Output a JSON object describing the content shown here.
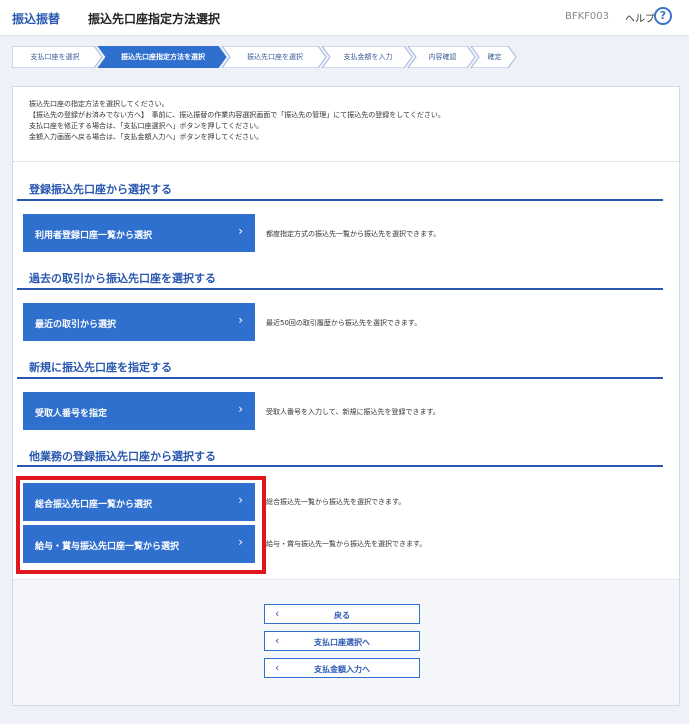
{
  "header": {
    "app_name": "振込振替",
    "page_title": "振込先口座指定方法選択",
    "screen_code": "BFKF003",
    "help_label": "ヘルプ",
    "help_icon": "?"
  },
  "steps": [
    {
      "label": "支払口座を選択",
      "active": false
    },
    {
      "label": "振込先口座指定方法を選択",
      "active": true
    },
    {
      "label": "振込先口座を選択",
      "active": false
    },
    {
      "label": "支払金額を入力",
      "active": false
    },
    {
      "label": "内容確認",
      "active": false
    },
    {
      "label": "確定",
      "active": false
    }
  ],
  "intro": {
    "lines": [
      "振込先口座の指定方法を選択してください。",
      "【振込先の登録がお済みでない方へ】　事前に、振込振替の作業内容選択画面で「振込先の管理」にて振込先の登録をしてください。",
      "支払口座を修正する場合は、「支払口座選択へ」ボタンを押してください。",
      "金額入力画面へ戻る場合は、「支払金額入力へ」ボタンを押してください。"
    ]
  },
  "sections": [
    {
      "title": "登録振込先口座から選択する",
      "buttons": [
        {
          "label": "利用者登録口座一覧から選択",
          "desc": "都度指定方式の振込先一覧から振込先を選択できます。"
        }
      ]
    },
    {
      "title": "過去の取引から振込先口座を選択する",
      "buttons": [
        {
          "label": "最近の取引から選択",
          "desc": "最近50回の取引履歴から振込先を選択できます。"
        }
      ]
    },
    {
      "title": "新規に振込先口座を指定する",
      "buttons": [
        {
          "label": "受取人番号を指定",
          "desc": "受取人番号を入力して、新規に振込先を登録できます。"
        }
      ]
    },
    {
      "title": "他業務の登録振込先口座から選択する",
      "buttons": [
        {
          "label": "総合振込先口座一覧から選択",
          "desc": "総合振込先一覧から振込先を選択できます。"
        },
        {
          "label": "給与・賞与振込先口座一覧から選択",
          "desc": "給与・賞与振込先一覧から振込先を選択できます。"
        }
      ]
    }
  ],
  "footer_buttons": [
    {
      "label": "戻る"
    },
    {
      "label": "支払口座選択へ"
    },
    {
      "label": "支払金額入力へ"
    }
  ],
  "colors": {
    "accent": "#2f6fce",
    "highlight": "#e0161d"
  },
  "icons": {
    "chevron_right": "›",
    "chevron_left": "‹"
  }
}
